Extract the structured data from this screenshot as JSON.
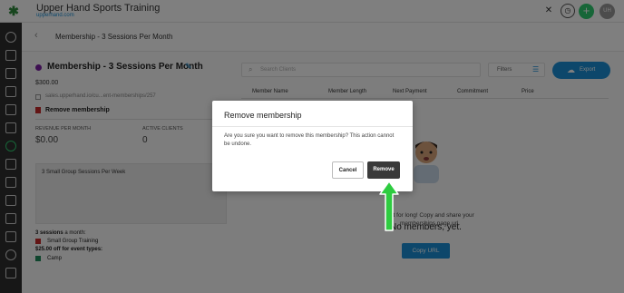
{
  "app": {
    "title": "Upper Hand Sports Training",
    "subdomain": "upperhand.com",
    "logo_icon": "glyph-icon",
    "avatar": "UH",
    "add_icon": "+",
    "accent": "#1a8fd6",
    "green": "#2ecc71"
  },
  "header": {
    "back": "‹",
    "title": "Membership - 3 Sessions Per Month"
  },
  "membership": {
    "name": "Membership - 3 Sessions Per Month",
    "price": "$300.00",
    "url": "sales.upperhand.io/cu...ent-memberships/257",
    "remove_label": "Remove membership",
    "revenue_label": "REVENUE PER MONTH",
    "revenue_value": "$0.00",
    "clients_label": "ACTIVE CLIENTS",
    "clients_value": "0",
    "description": "3 Small Group Sessions Per Week",
    "sessions_bold": "3 sessions",
    "sessions_rest": " a month:",
    "sessions_item": "Small Group Training",
    "discount": "$25.00 off for event types:",
    "discount_item": "Camp"
  },
  "toolbar": {
    "search_placeholder": "Search Clients",
    "filters": "Filters",
    "export": "Export"
  },
  "table": {
    "headers": [
      "Member Name",
      "Member Length",
      "Next Payment",
      "Commitment",
      "Price"
    ]
  },
  "empty": {
    "title": "No members, yet.",
    "subtitle": "Not for long! Copy and share your memberships page url.",
    "copy_btn": "Copy URL"
  },
  "modal": {
    "title": "Remove membership",
    "body": "Are you sure you want to remove this membership? This action cannot be undone.",
    "cancel": "Cancel",
    "remove": "Remove"
  }
}
